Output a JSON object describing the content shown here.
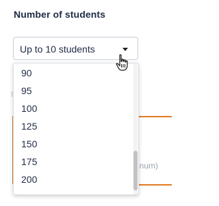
{
  "field": {
    "label": "Number of students",
    "selected_value": "Up to 10 students"
  },
  "dropdown": {
    "options": [
      "90",
      "95",
      "100",
      "125",
      "150",
      "175",
      "200"
    ]
  },
  "background": {
    "partial_text": "nnum)"
  },
  "colors": {
    "accent": "#e07b21",
    "text": "#1f2a44",
    "border": "#c7cdd6"
  },
  "icons": {
    "caret": "chevron-down-icon",
    "cursor": "hand-pointer-icon"
  }
}
